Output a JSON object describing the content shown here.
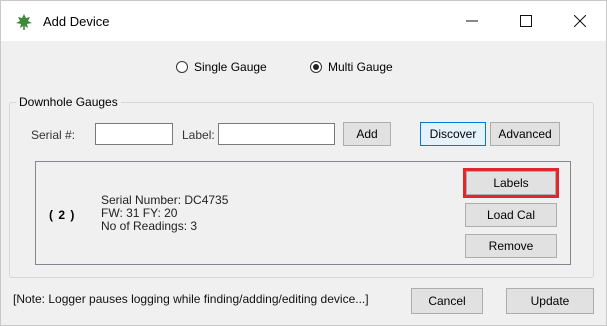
{
  "window": {
    "title": "Add Device"
  },
  "mode": {
    "options": [
      {
        "label": "Single Gauge",
        "checked": false
      },
      {
        "label": "Multi Gauge",
        "checked": true
      }
    ]
  },
  "group": {
    "title": "Downhole Gauges"
  },
  "form": {
    "serial_label": "Serial #:",
    "serial_value": "",
    "label_label": "Label:",
    "label_value": "",
    "add_label": "Add",
    "discover_label": "Discover",
    "advanced_label": "Advanced"
  },
  "device": {
    "index": "( 2 )",
    "serial_number": "Serial Number: DC4735",
    "firmware": "FW: 31 FY: 20",
    "readings": "No of Readings: 3",
    "labels_button": "Labels",
    "load_cal_button": "Load Cal",
    "remove_button": "Remove"
  },
  "footer": {
    "note": "[Note: Logger pauses logging while finding/adding/editing device...]",
    "cancel_label": "Cancel",
    "update_label": "Update"
  },
  "colors": {
    "highlight": "#e3262a",
    "focus_border": "#0078d7",
    "icon_green": "#3c8a3a"
  }
}
